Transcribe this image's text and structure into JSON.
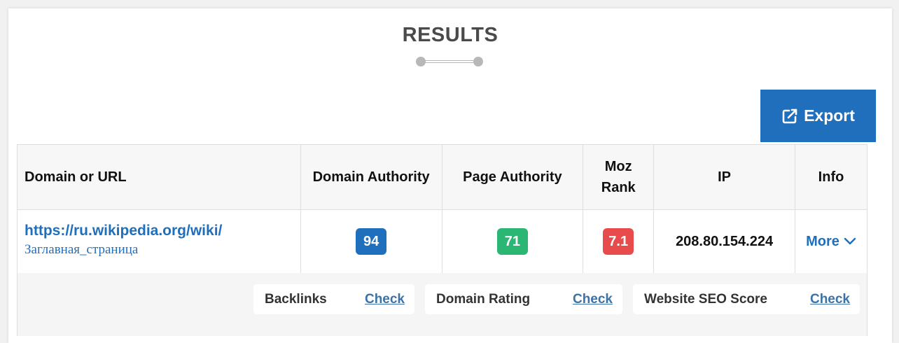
{
  "header": {
    "title": "RESULTS"
  },
  "toolbar": {
    "export_label": "Export",
    "accent_color": "#1f6fbd"
  },
  "table": {
    "columns": [
      "Domain or URL",
      "Domain Authority",
      "Page Authority",
      "Moz Rank",
      "IP",
      "Info"
    ],
    "rows": [
      {
        "url": "https://ru.wikipedia.org/wiki/",
        "page": "Заглавная_страница",
        "domain_authority": "94",
        "page_authority": "71",
        "moz_rank": "7.1",
        "ip": "208.80.154.224",
        "info": "More"
      }
    ]
  },
  "badge_colors": {
    "domain_authority": "#1f6fbd",
    "page_authority": "#2bb673",
    "moz_rank": "#e84b4b"
  },
  "extra_checks": [
    {
      "label": "Backlinks",
      "action": "Check"
    },
    {
      "label": "Domain Rating",
      "action": "Check"
    },
    {
      "label": "Website SEO Score",
      "action": "Check"
    }
  ]
}
